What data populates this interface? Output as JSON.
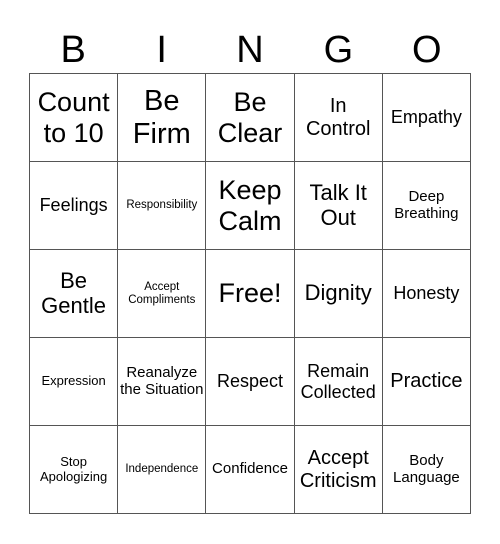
{
  "header": {
    "letters": [
      "B",
      "I",
      "N",
      "G",
      "O"
    ]
  },
  "cells": [
    [
      "Count to 10",
      "Be Firm",
      "Be Clear",
      "In Control",
      "Empathy"
    ],
    [
      "Feelings",
      "Responsibility",
      "Keep Calm",
      "Talk It Out",
      "Deep Breathing"
    ],
    [
      "Be Gentle",
      "Accept Compliments",
      "Free!",
      "Dignity",
      "Honesty"
    ],
    [
      "Expression",
      "Reanalyze the Situation",
      "Respect",
      "Remain Collected",
      "Practice"
    ],
    [
      "Stop Apologizing",
      "Independence",
      "Confidence",
      "Accept Criticism",
      "Body Language"
    ]
  ],
  "free_space": "Free!"
}
